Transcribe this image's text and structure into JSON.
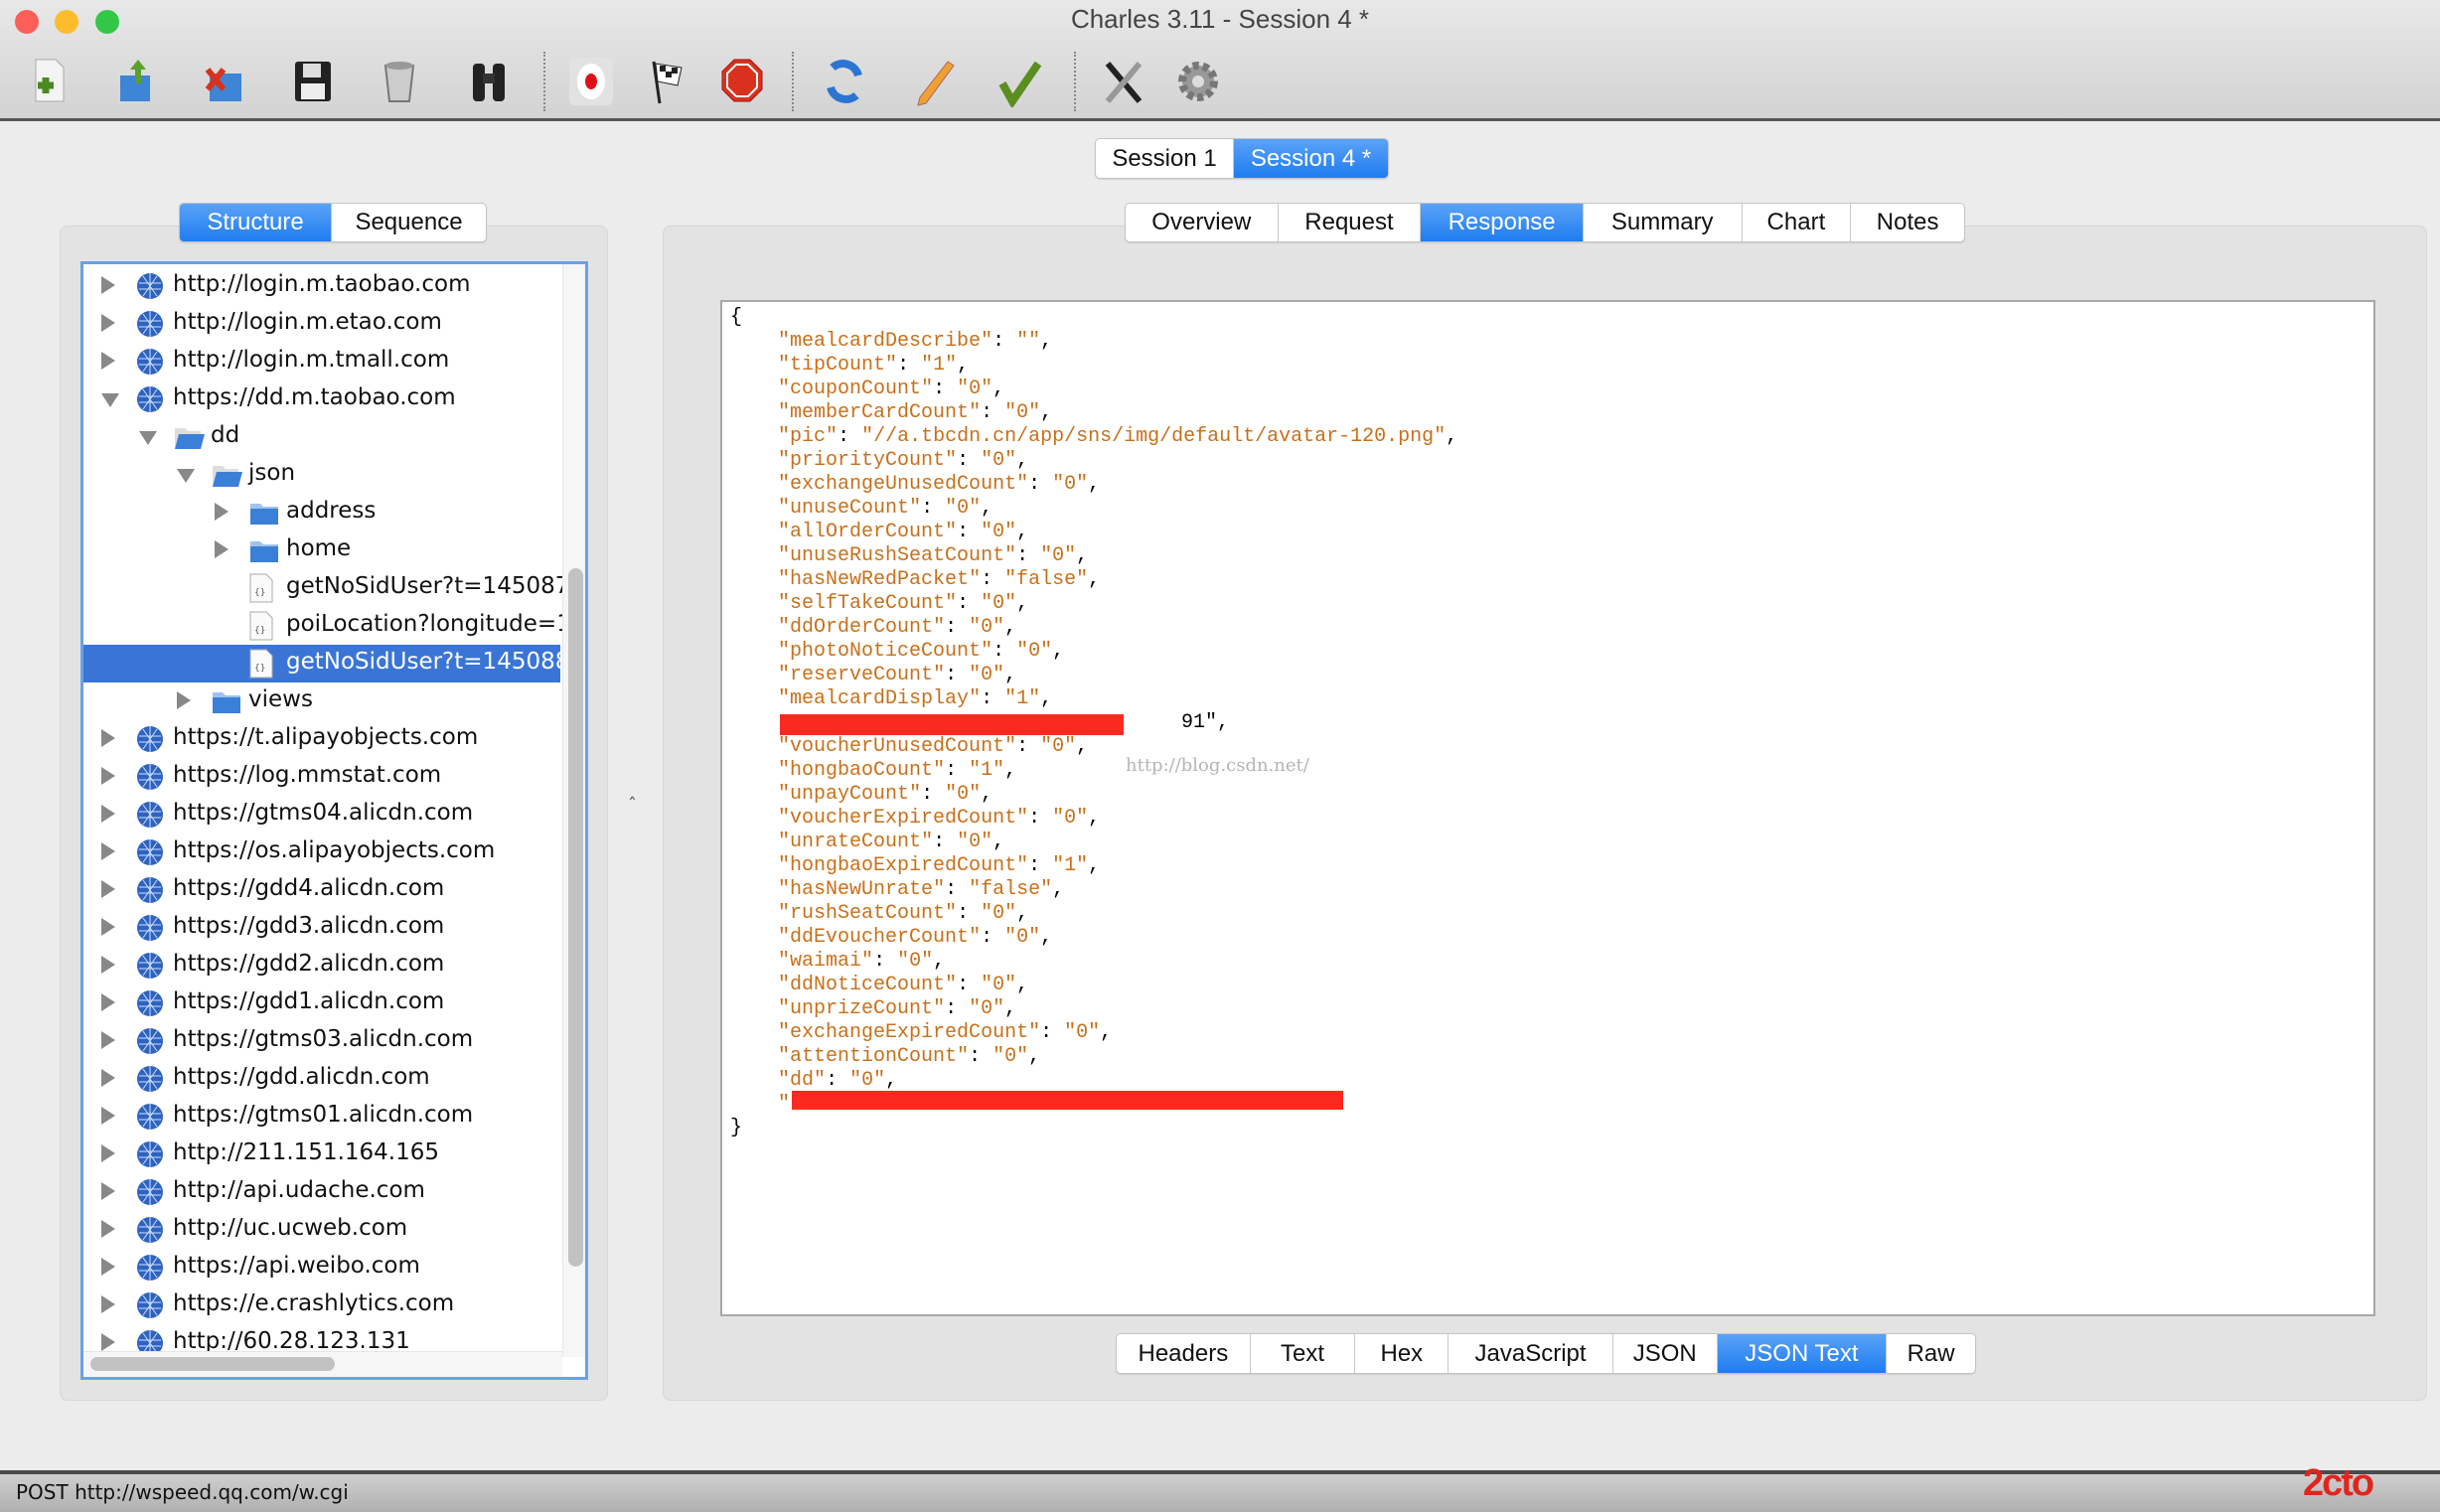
{
  "window": {
    "title": "Charles 3.11 - Session 4 *"
  },
  "toolbar": {
    "tools": [
      {
        "name": "new-session-icon"
      },
      {
        "name": "open-session-icon"
      },
      {
        "name": "close-session-icon"
      },
      {
        "name": "save-icon"
      },
      {
        "name": "clear-trash-icon"
      },
      {
        "name": "find-binoculars-icon"
      },
      {
        "name": "record-icon",
        "active": true
      },
      {
        "name": "throttle-flag-icon"
      },
      {
        "name": "breakpoints-stop-icon"
      },
      {
        "name": "repeat-refresh-icon"
      },
      {
        "name": "edit-pencil-icon"
      },
      {
        "name": "validate-check-icon"
      },
      {
        "name": "tools-icon"
      },
      {
        "name": "settings-gear-icon"
      }
    ]
  },
  "sessions": {
    "tabs": [
      "Session 1",
      "Session 4 *"
    ],
    "active": 1
  },
  "view_mode": {
    "tabs": [
      "Structure",
      "Sequence"
    ],
    "active": 0
  },
  "tree": {
    "items": [
      {
        "label": "http://login.m.taobao.com",
        "level": 0,
        "type": "host",
        "expander": "collapsed"
      },
      {
        "label": "http://login.m.etao.com",
        "level": 0,
        "type": "host",
        "expander": "collapsed"
      },
      {
        "label": "http://login.m.tmall.com",
        "level": 0,
        "type": "host",
        "expander": "collapsed"
      },
      {
        "label": "https://dd.m.taobao.com",
        "level": 0,
        "type": "host",
        "expander": "expanded"
      },
      {
        "label": "dd",
        "level": 1,
        "type": "folder-open",
        "expander": "expanded"
      },
      {
        "label": "json",
        "level": 2,
        "type": "folder-open",
        "expander": "expanded"
      },
      {
        "label": "address",
        "level": 3,
        "type": "folder",
        "expander": "collapsed"
      },
      {
        "label": "home",
        "level": 3,
        "type": "folder",
        "expander": "collapsed"
      },
      {
        "label": "getNoSidUser?t=145087",
        "level": 3,
        "type": "file",
        "expander": "none"
      },
      {
        "label": "poiLocation?longitude=1",
        "level": 3,
        "type": "file",
        "expander": "none"
      },
      {
        "label": "getNoSidUser?t=145088",
        "level": 3,
        "type": "file",
        "expander": "none",
        "selected": true
      },
      {
        "label": "views",
        "level": 2,
        "type": "folder",
        "expander": "collapsed"
      },
      {
        "label": "https://t.alipayobjects.com",
        "level": 0,
        "type": "host",
        "expander": "collapsed"
      },
      {
        "label": "https://log.mmstat.com",
        "level": 0,
        "type": "host",
        "expander": "collapsed"
      },
      {
        "label": "https://gtms04.alicdn.com",
        "level": 0,
        "type": "host",
        "expander": "collapsed"
      },
      {
        "label": "https://os.alipayobjects.com",
        "level": 0,
        "type": "host",
        "expander": "collapsed"
      },
      {
        "label": "https://gdd4.alicdn.com",
        "level": 0,
        "type": "host",
        "expander": "collapsed"
      },
      {
        "label": "https://gdd3.alicdn.com",
        "level": 0,
        "type": "host",
        "expander": "collapsed"
      },
      {
        "label": "https://gdd2.alicdn.com",
        "level": 0,
        "type": "host",
        "expander": "collapsed"
      },
      {
        "label": "https://gdd1.alicdn.com",
        "level": 0,
        "type": "host",
        "expander": "collapsed"
      },
      {
        "label": "https://gtms03.alicdn.com",
        "level": 0,
        "type": "host",
        "expander": "collapsed"
      },
      {
        "label": "https://gdd.alicdn.com",
        "level": 0,
        "type": "host",
        "expander": "collapsed"
      },
      {
        "label": "https://gtms01.alicdn.com",
        "level": 0,
        "type": "host",
        "expander": "collapsed"
      },
      {
        "label": "http://211.151.164.165",
        "level": 0,
        "type": "host",
        "expander": "collapsed"
      },
      {
        "label": "http://api.udache.com",
        "level": 0,
        "type": "host",
        "expander": "collapsed"
      },
      {
        "label": "http://uc.ucweb.com",
        "level": 0,
        "type": "host",
        "expander": "collapsed"
      },
      {
        "label": "https://api.weibo.com",
        "level": 0,
        "type": "host",
        "expander": "collapsed"
      },
      {
        "label": "https://e.crashlytics.com",
        "level": 0,
        "type": "host",
        "expander": "collapsed"
      },
      {
        "label": "http://60.28.123.131",
        "level": 0,
        "type": "host",
        "expander": "collapsed"
      }
    ]
  },
  "detail_tabs": {
    "tabs": [
      "Overview",
      "Request",
      "Response",
      "Summary",
      "Chart",
      "Notes"
    ],
    "active": 2
  },
  "response": {
    "open": "{",
    "close": "}",
    "entries": [
      [
        "mealcardDescribe",
        ""
      ],
      [
        "tipCount",
        "1"
      ],
      [
        "couponCount",
        "0"
      ],
      [
        "memberCardCount",
        "0"
      ],
      [
        "pic",
        "//a.tbcdn.cn/app/sns/img/default/avatar-120.png"
      ],
      [
        "priorityCount",
        "0"
      ],
      [
        "exchangeUnusedCount",
        "0"
      ],
      [
        "unuseCount",
        "0"
      ],
      [
        "allOrderCount",
        "0"
      ],
      [
        "unuseRushSeatCount",
        "0"
      ],
      [
        "hasNewRedPacket",
        "false"
      ],
      [
        "selfTakeCount",
        "0"
      ],
      [
        "ddOrderCount",
        "0"
      ],
      [
        "photoNoticeCount",
        "0"
      ],
      [
        "reserveCount",
        "0"
      ],
      [
        "mealcardDisplay",
        "1"
      ],
      null,
      [
        "voucherUnusedCount",
        "0"
      ],
      [
        "hongbaoCount",
        "1"
      ],
      [
        "unpayCount",
        "0"
      ],
      [
        "voucherExpiredCount",
        "0"
      ],
      [
        "unrateCount",
        "0"
      ],
      [
        "hongbaoExpiredCount",
        "1"
      ],
      [
        "hasNewUnrate",
        "false"
      ],
      [
        "rushSeatCount",
        "0"
      ],
      [
        "ddEvoucherCount",
        "0"
      ],
      [
        "waimai",
        "0"
      ],
      [
        "ddNoticeCount",
        "0"
      ],
      [
        "unprizeCount",
        "0"
      ],
      [
        "exchangeExpiredCount",
        "0"
      ],
      [
        "attentionCount",
        "0"
      ],
      [
        "dd",
        "0"
      ],
      null
    ],
    "redacted_tail_1": "91\",",
    "watermark": "http://blog.csdn.net/",
    "redaction_color": "#fb2a1f",
    "string_color": "#c8701a"
  },
  "body_tabs": {
    "tabs": [
      "Headers",
      "Text",
      "Hex",
      "JavaScript",
      "JSON",
      "JSON Text",
      "Raw"
    ],
    "active": 5
  },
  "status_bar": {
    "text": "POST http://wspeed.qq.com/w.cgi",
    "corner_logo": "2cto.com"
  }
}
